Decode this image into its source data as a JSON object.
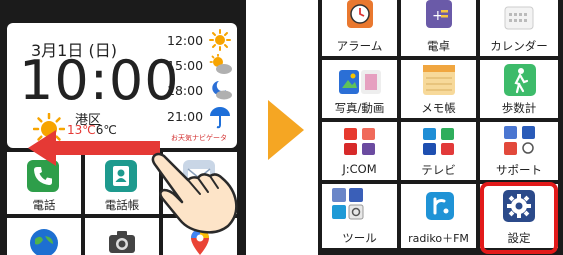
{
  "left_screen": {
    "widget": {
      "date": "3月1日 (日)",
      "time": "10:00",
      "location": "港区",
      "temp_high": "13℃",
      "temp_low": "6℃",
      "forecast": [
        {
          "time": "12:00",
          "icon": "sun-icon"
        },
        {
          "time": "15:00",
          "icon": "sun-cloud-icon"
        },
        {
          "time": "18:00",
          "icon": "moon-cloud-icon"
        },
        {
          "time": "21:00",
          "icon": "umbrella-icon"
        }
      ],
      "brand": "お天気ナビゲータ"
    },
    "apps": [
      {
        "label": "電話",
        "icon": "phone-icon"
      },
      {
        "label": "電話帳",
        "icon": "contacts-icon"
      },
      {
        "label": "",
        "icon": "mail-icon"
      }
    ],
    "bottom_apps": [
      {
        "icon": "globe-icon"
      },
      {
        "icon": "camera-icon"
      },
      {
        "icon": "maps-icon"
      }
    ]
  },
  "right_screen": {
    "apps": [
      {
        "label": "アラーム",
        "icon": "alarm-icon"
      },
      {
        "label": "電卓",
        "icon": "calculator-icon"
      },
      {
        "label": "カレンダー",
        "icon": "calendar-icon"
      },
      {
        "label": "写真/動画",
        "icon": "photos-icon"
      },
      {
        "label": "メモ帳",
        "icon": "notepad-icon"
      },
      {
        "label": "歩数計",
        "icon": "pedometer-icon"
      },
      {
        "label": "J:COM",
        "icon": "jcom-folder-icon"
      },
      {
        "label": "テレビ",
        "icon": "tv-folder-icon"
      },
      {
        "label": "サポート",
        "icon": "support-folder-icon"
      },
      {
        "label": "ツール",
        "icon": "tools-folder-icon"
      },
      {
        "label": "radiko＋FM",
        "icon": "radiko-icon"
      },
      {
        "label": "設定",
        "icon": "settings-icon"
      }
    ],
    "highlighted": "設定"
  },
  "colors": {
    "accent_orange": "#f5a623",
    "arrow_red": "#e53935",
    "highlight_red": "#e21a1a",
    "sun": "#f7a400"
  }
}
